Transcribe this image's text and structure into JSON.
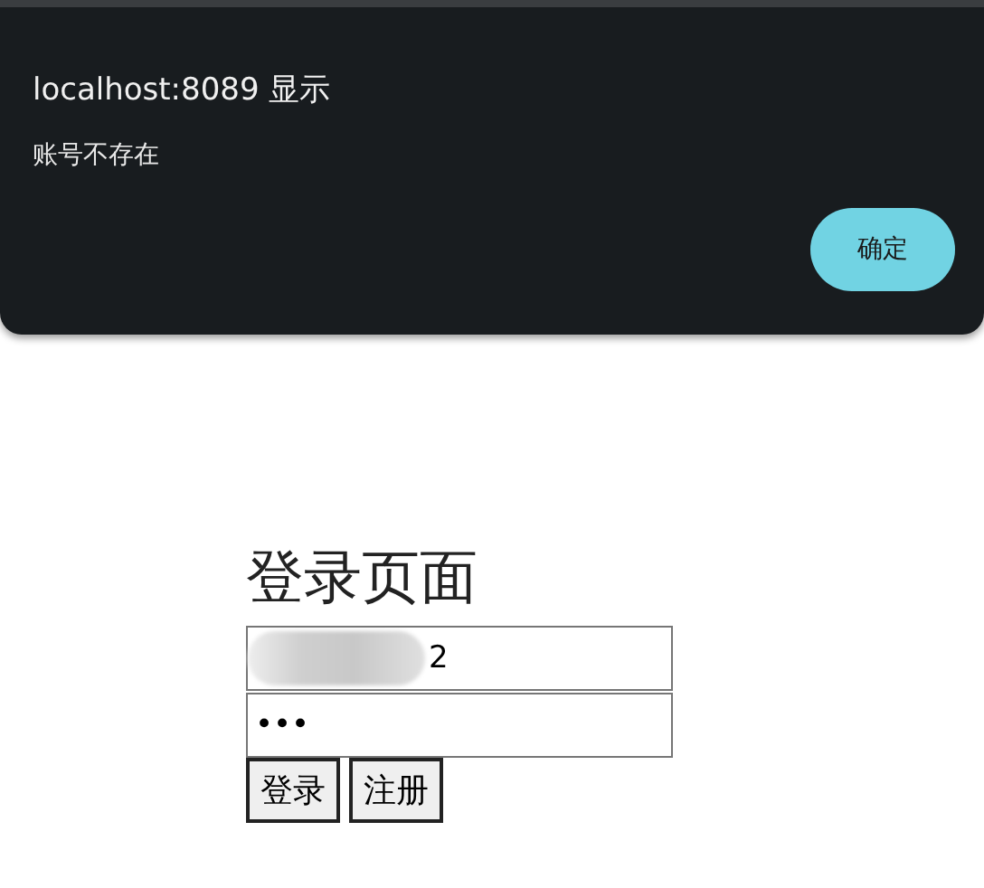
{
  "dialog": {
    "title": "localhost:8089 显示",
    "message": "账号不存在",
    "button": "确定"
  },
  "page": {
    "heading": "登录页面",
    "username": {
      "value": "2",
      "redacted": true
    },
    "password": {
      "value": "•••"
    },
    "buttons": [
      "登录",
      "注册"
    ]
  }
}
